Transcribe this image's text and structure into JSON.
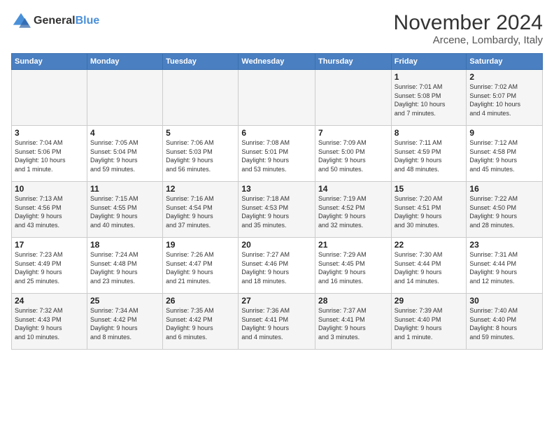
{
  "header": {
    "logo_line1": "General",
    "logo_line2": "Blue",
    "month": "November 2024",
    "location": "Arcene, Lombardy, Italy"
  },
  "weekdays": [
    "Sunday",
    "Monday",
    "Tuesday",
    "Wednesday",
    "Thursday",
    "Friday",
    "Saturday"
  ],
  "weeks": [
    [
      {
        "day": "",
        "info": ""
      },
      {
        "day": "",
        "info": ""
      },
      {
        "day": "",
        "info": ""
      },
      {
        "day": "",
        "info": ""
      },
      {
        "day": "",
        "info": ""
      },
      {
        "day": "1",
        "info": "Sunrise: 7:01 AM\nSunset: 5:08 PM\nDaylight: 10 hours\nand 7 minutes."
      },
      {
        "day": "2",
        "info": "Sunrise: 7:02 AM\nSunset: 5:07 PM\nDaylight: 10 hours\nand 4 minutes."
      }
    ],
    [
      {
        "day": "3",
        "info": "Sunrise: 7:04 AM\nSunset: 5:06 PM\nDaylight: 10 hours\nand 1 minute."
      },
      {
        "day": "4",
        "info": "Sunrise: 7:05 AM\nSunset: 5:04 PM\nDaylight: 9 hours\nand 59 minutes."
      },
      {
        "day": "5",
        "info": "Sunrise: 7:06 AM\nSunset: 5:03 PM\nDaylight: 9 hours\nand 56 minutes."
      },
      {
        "day": "6",
        "info": "Sunrise: 7:08 AM\nSunset: 5:01 PM\nDaylight: 9 hours\nand 53 minutes."
      },
      {
        "day": "7",
        "info": "Sunrise: 7:09 AM\nSunset: 5:00 PM\nDaylight: 9 hours\nand 50 minutes."
      },
      {
        "day": "8",
        "info": "Sunrise: 7:11 AM\nSunset: 4:59 PM\nDaylight: 9 hours\nand 48 minutes."
      },
      {
        "day": "9",
        "info": "Sunrise: 7:12 AM\nSunset: 4:58 PM\nDaylight: 9 hours\nand 45 minutes."
      }
    ],
    [
      {
        "day": "10",
        "info": "Sunrise: 7:13 AM\nSunset: 4:56 PM\nDaylight: 9 hours\nand 43 minutes."
      },
      {
        "day": "11",
        "info": "Sunrise: 7:15 AM\nSunset: 4:55 PM\nDaylight: 9 hours\nand 40 minutes."
      },
      {
        "day": "12",
        "info": "Sunrise: 7:16 AM\nSunset: 4:54 PM\nDaylight: 9 hours\nand 37 minutes."
      },
      {
        "day": "13",
        "info": "Sunrise: 7:18 AM\nSunset: 4:53 PM\nDaylight: 9 hours\nand 35 minutes."
      },
      {
        "day": "14",
        "info": "Sunrise: 7:19 AM\nSunset: 4:52 PM\nDaylight: 9 hours\nand 32 minutes."
      },
      {
        "day": "15",
        "info": "Sunrise: 7:20 AM\nSunset: 4:51 PM\nDaylight: 9 hours\nand 30 minutes."
      },
      {
        "day": "16",
        "info": "Sunrise: 7:22 AM\nSunset: 4:50 PM\nDaylight: 9 hours\nand 28 minutes."
      }
    ],
    [
      {
        "day": "17",
        "info": "Sunrise: 7:23 AM\nSunset: 4:49 PM\nDaylight: 9 hours\nand 25 minutes."
      },
      {
        "day": "18",
        "info": "Sunrise: 7:24 AM\nSunset: 4:48 PM\nDaylight: 9 hours\nand 23 minutes."
      },
      {
        "day": "19",
        "info": "Sunrise: 7:26 AM\nSunset: 4:47 PM\nDaylight: 9 hours\nand 21 minutes."
      },
      {
        "day": "20",
        "info": "Sunrise: 7:27 AM\nSunset: 4:46 PM\nDaylight: 9 hours\nand 18 minutes."
      },
      {
        "day": "21",
        "info": "Sunrise: 7:29 AM\nSunset: 4:45 PM\nDaylight: 9 hours\nand 16 minutes."
      },
      {
        "day": "22",
        "info": "Sunrise: 7:30 AM\nSunset: 4:44 PM\nDaylight: 9 hours\nand 14 minutes."
      },
      {
        "day": "23",
        "info": "Sunrise: 7:31 AM\nSunset: 4:44 PM\nDaylight: 9 hours\nand 12 minutes."
      }
    ],
    [
      {
        "day": "24",
        "info": "Sunrise: 7:32 AM\nSunset: 4:43 PM\nDaylight: 9 hours\nand 10 minutes."
      },
      {
        "day": "25",
        "info": "Sunrise: 7:34 AM\nSunset: 4:42 PM\nDaylight: 9 hours\nand 8 minutes."
      },
      {
        "day": "26",
        "info": "Sunrise: 7:35 AM\nSunset: 4:42 PM\nDaylight: 9 hours\nand 6 minutes."
      },
      {
        "day": "27",
        "info": "Sunrise: 7:36 AM\nSunset: 4:41 PM\nDaylight: 9 hours\nand 4 minutes."
      },
      {
        "day": "28",
        "info": "Sunrise: 7:37 AM\nSunset: 4:41 PM\nDaylight: 9 hours\nand 3 minutes."
      },
      {
        "day": "29",
        "info": "Sunrise: 7:39 AM\nSunset: 4:40 PM\nDaylight: 9 hours\nand 1 minute."
      },
      {
        "day": "30",
        "info": "Sunrise: 7:40 AM\nSunset: 4:40 PM\nDaylight: 8 hours\nand 59 minutes."
      }
    ]
  ]
}
